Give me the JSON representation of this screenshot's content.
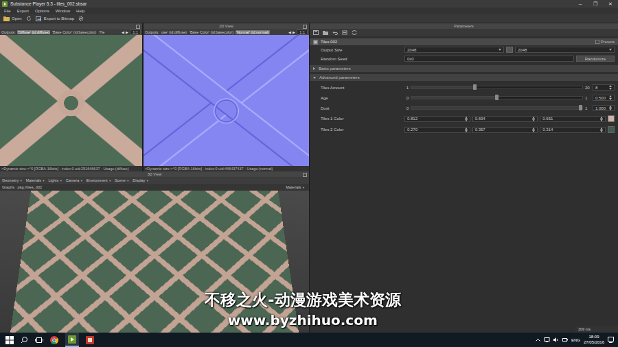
{
  "window": {
    "title": "Substance Player 5.3 - tiles_002.sbsar",
    "controls": [
      "─",
      "❐",
      "✕"
    ]
  },
  "menu": [
    "File",
    "Export",
    "Options",
    "Window",
    "Help"
  ],
  "toolbar": {
    "open": "Open",
    "export": "Export to Bitmap"
  },
  "views2d": [
    {
      "outputs_label": "Outputs:",
      "outputs": [
        {
          "label": "'Diffuse' (id:diffuse)",
          "selected": true
        },
        {
          "label": "'Base Color' (id:basecolor)",
          "selected": false
        },
        {
          "label": "'He",
          "selected": false
        }
      ],
      "prev": "◀",
      "next": "▶",
      "zoom": "1:1",
      "footer": "<Dynamic size:>^0 [RGBA-16bits] - index:0 uid:251646637 - Usage:(diffuse)",
      "kind": "diffuse"
    },
    {
      "title": "2D View",
      "outputs_label": "Outputs:",
      "outputs": [
        {
          "label": "use' (id:diffuse)",
          "selected": false
        },
        {
          "label": "'Base Color' (id:basecolor)",
          "selected": false
        },
        {
          "label": "'Normal' (id:normal)",
          "selected": true
        }
      ],
      "prev": "◀",
      "next": "▶",
      "zoom": "1:1",
      "footer": "<Dynamic size:>^0 [RGBA-16bits] - index:0 uid:446437437 - Usage:(normal)",
      "kind": "normal"
    }
  ],
  "view3d": {
    "title": "3D View",
    "menus": [
      "Geometry",
      "Materials",
      "Lights",
      "Camera",
      "Environment",
      "Scene",
      "Display"
    ],
    "arrow": "▼",
    "graphs": "Graphs : pkg://tiles_002",
    "materials": "Materials"
  },
  "watermark": {
    "line1": "不移之火-动漫游戏美术资源",
    "line2": "www.byzhihuo.com"
  },
  "parameters": {
    "title": "Parameters",
    "graph": "Tiles 002",
    "presets": "Presets",
    "output_size": {
      "label": "Output Size",
      "width": "2048",
      "height": "2048"
    },
    "random_seed": {
      "label": "Random Seed",
      "value": "0x0",
      "button": "Randomize"
    },
    "groups": [
      {
        "label": "Basic parameters",
        "expanded": false
      },
      {
        "label": "Advanced parameters",
        "expanded": true
      }
    ],
    "rows": [
      {
        "kind": "slider",
        "label": "Tiles Amount",
        "min": "1",
        "max": "20",
        "value": "8",
        "level": 0.368
      },
      {
        "kind": "slider",
        "label": "Age",
        "min": "0",
        "max": "1",
        "value": "0.500",
        "level": 0.5
      },
      {
        "kind": "slider",
        "label": "Dust",
        "min": "0",
        "max": "1",
        "value": "1.000",
        "level": 1
      },
      {
        "kind": "color",
        "label": "Tiles 1 Color",
        "values": [
          "0.812",
          "0.694",
          "0.651"
        ],
        "color": "#cfb1a6"
      },
      {
        "kind": "color",
        "label": "Tiles 2 Color",
        "values": [
          "0.270",
          "0.357",
          "0.314"
        ],
        "color": "#455b50"
      }
    ]
  },
  "status": "309 ms",
  "taskbar": {
    "lang": "ENG",
    "time": "18:09",
    "date": "27/05/2016"
  }
}
